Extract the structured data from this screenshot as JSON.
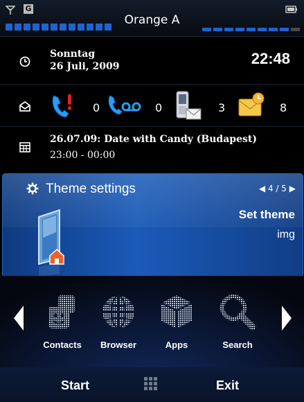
{
  "status_bar": {
    "carrier": "Orange A",
    "icons": [
      "signal-antenna-icon",
      "gprs-icon",
      "battery-icon"
    ],
    "gprs_letter": "G"
  },
  "today": {
    "day": "Sonntag",
    "date": "26 Juli, 2009",
    "time": "22:48"
  },
  "messages": {
    "missed_calls": "0",
    "voicemail": "0",
    "sms": "3",
    "email": "8"
  },
  "appointment": {
    "title": "26.07.09: Date with Candy (Budapest)",
    "time": "23:00 - 00:00"
  },
  "theme_panel": {
    "title": "Theme settings",
    "pager": "4 / 5",
    "action": "Set theme",
    "value": "img"
  },
  "launcher": {
    "apps": [
      {
        "label": "Contacts",
        "icon": "contacts-icon"
      },
      {
        "label": "Browser",
        "icon": "globe-icon"
      },
      {
        "label": "Apps",
        "icon": "cube-icon"
      },
      {
        "label": "Search",
        "icon": "magnifier-icon"
      }
    ]
  },
  "softkeys": {
    "left": "Start",
    "right": "Exit"
  },
  "colors": {
    "accent": "#1d64ce",
    "panel": "#1a5bb8",
    "background": "#000000"
  }
}
